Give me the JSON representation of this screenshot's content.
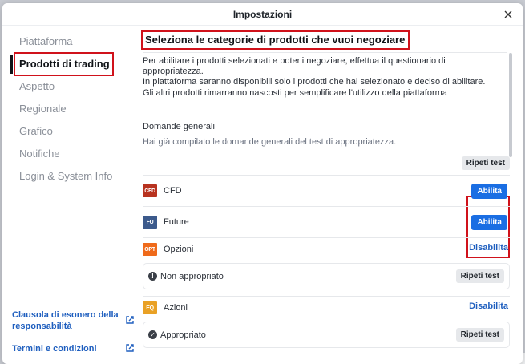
{
  "dialog": {
    "title": "Impostazioni"
  },
  "sidebar": {
    "items": [
      {
        "label": "Piattaforma"
      },
      {
        "label": "Prodotti di trading"
      },
      {
        "label": "Aspetto"
      },
      {
        "label": "Regionale"
      },
      {
        "label": "Grafico"
      },
      {
        "label": "Notifiche"
      },
      {
        "label": "Login & System Info"
      }
    ],
    "links": [
      {
        "label": "Clausola di esonero della responsabilità"
      },
      {
        "label": "Termini e condizioni"
      }
    ]
  },
  "main": {
    "title": "Seleziona le categorie di prodotti che vuoi negoziare",
    "intro": [
      "Per abilitare i prodotti selezionati e poterli negoziare, effettua il questionario di appropriatezza.",
      "In piattaforma saranno disponibili solo i prodotti che hai selezionato e deciso di abilitare. Gli altri prodotti rimarranno nascosti per semplificare l'utilizzo della piattaforma"
    ],
    "general": {
      "label": "Domande generali",
      "sub": "Hai già compilato le domande generali del test di appropriatezza.",
      "retest": "Ripeti test"
    },
    "products": [
      {
        "icon": "CFD",
        "icon_color": "#b8321f",
        "name": "CFD",
        "action": "Abilita"
      },
      {
        "icon": "FU",
        "icon_color": "#3c5a8c",
        "name": "Future",
        "action": "Abilita"
      },
      {
        "icon": "OPT",
        "icon_color": "#ef6a1a",
        "name": "Opzioni",
        "action": "Disabilita",
        "status": {
          "icon": "!",
          "text": "Non appropriato",
          "retest": "Ripeti test"
        }
      },
      {
        "icon": "EQ",
        "icon_color": "#e9a125",
        "name": "Azioni",
        "action": "Disabilita",
        "status": {
          "icon": "✓",
          "text": "Appropriato",
          "retest": "Ripeti test"
        }
      }
    ]
  },
  "colors": {
    "accent": "#1a6ee3",
    "highlight": "#d0121b",
    "link": "#1f5fbf"
  }
}
